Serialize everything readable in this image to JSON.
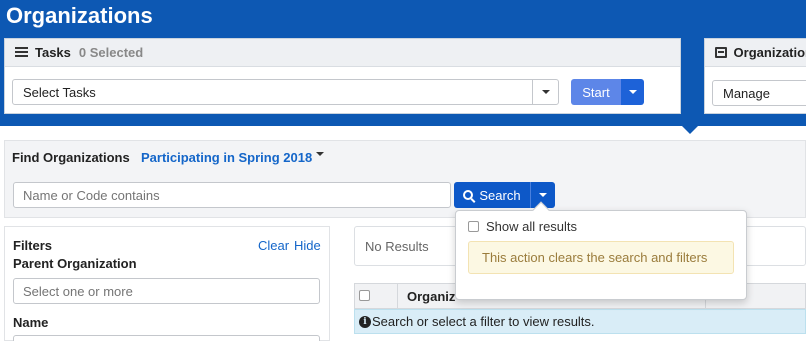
{
  "page": {
    "title": "Organizations"
  },
  "tasks_panel": {
    "title": "Tasks",
    "selected_count": "0 Selected",
    "select_value": "Select Tasks",
    "start_label": "Start"
  },
  "org_panel": {
    "title": "Organization",
    "select_value": "Manage"
  },
  "find": {
    "label": "Find Organizations",
    "filter_value": "Participating in Spring 2018",
    "search_placeholder": "Name or Code contains",
    "search_button": "Search"
  },
  "dropdown": {
    "show_all_label": "Show all results",
    "warning": "This action clears the search and filters"
  },
  "filters": {
    "title": "Filters",
    "clear_label": "Clear",
    "hide_label": "Hide",
    "parent_org_label": "Parent Organization",
    "parent_org_placeholder": "Select one or more",
    "name_label": "Name"
  },
  "results": {
    "no_results": "No Results",
    "column_header": "Organiz",
    "info_icon": "i",
    "message": "Search or select a filter to view results."
  },
  "colors": {
    "brand_blue": "#0d58b3",
    "link_blue": "#1466c9",
    "start_button": "#5d86e8",
    "warning_bg": "#fcf8e3",
    "info_bg": "#d9edf7"
  },
  "icons": [
    "tasks-list-icon",
    "organization-card-icon",
    "search-icon",
    "info-icon",
    "caret-down-icon"
  ]
}
